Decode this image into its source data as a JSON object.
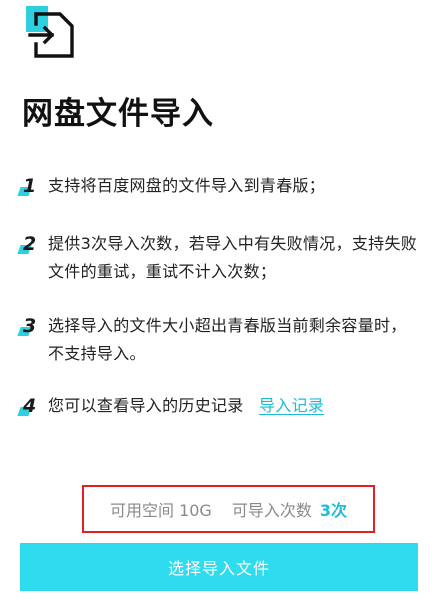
{
  "header": {
    "icon": "file-import-icon",
    "accent_color": "#2ed0e0",
    "title": "网盘文件导入"
  },
  "rules": [
    {
      "number": "1",
      "text": "支持将百度网盘的文件导入到青春版；"
    },
    {
      "number": "2",
      "text": "提供3次导入次数，若导入中有失败情况，支持失败文件的重试，重试不计入次数；"
    },
    {
      "number": "3",
      "text": "选择导入的文件大小超出青春版当前剩余容量时，不支持导入。"
    },
    {
      "number": "4",
      "text": "您可以查看导入的历史记录",
      "link": "导入记录"
    }
  ],
  "quota": {
    "space_label": "可用空间 10G",
    "count_label": "可导入次数",
    "count_value": "3次",
    "count_color": "#1ebcd6",
    "highlight_border_color": "#e02222"
  },
  "action": {
    "select_button_label": "选择导入文件",
    "button_color": "#2fdcef"
  }
}
